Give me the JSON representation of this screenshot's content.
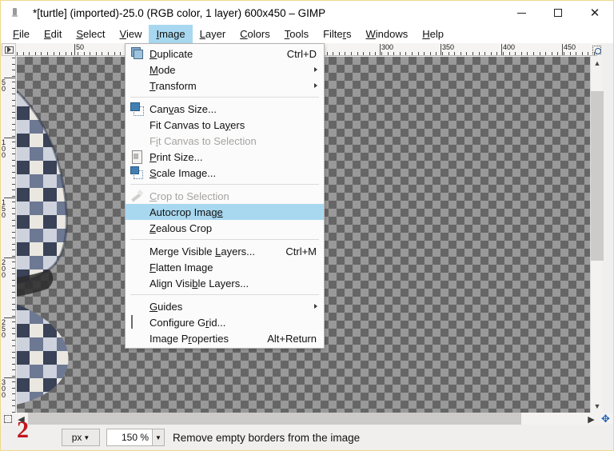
{
  "window": {
    "title": "*[turtle] (imported)-25.0 (RGB color, 1 layer) 600x450 – GIMP",
    "icon": "gimp-wilber-icon",
    "minimize_label": "",
    "maximize_label": "",
    "close_label": "✕"
  },
  "menubar": {
    "items": [
      {
        "label": "File",
        "mnemonic": "F",
        "active": false
      },
      {
        "label": "Edit",
        "mnemonic": "E",
        "active": false
      },
      {
        "label": "Select",
        "mnemonic": "S",
        "active": false
      },
      {
        "label": "View",
        "mnemonic": "V",
        "active": false
      },
      {
        "label": "Image",
        "mnemonic": "I",
        "active": true
      },
      {
        "label": "Layer",
        "mnemonic": "L",
        "active": false
      },
      {
        "label": "Colors",
        "mnemonic": "C",
        "active": false
      },
      {
        "label": "Tools",
        "mnemonic": "T",
        "active": false
      },
      {
        "label": "Filters",
        "mnemonic": "r",
        "active": false
      },
      {
        "label": "Windows",
        "mnemonic": "W",
        "active": false
      },
      {
        "label": "Help",
        "mnemonic": "H",
        "active": false
      }
    ]
  },
  "image_menu": {
    "title": "Image",
    "items": [
      {
        "label": "Duplicate",
        "accel": "Ctrl+D",
        "icon": "duplicate-icon",
        "submenu": false,
        "enabled": true,
        "highlighted": false
      },
      {
        "label": "Mode",
        "accel": "",
        "icon": "",
        "submenu": true,
        "enabled": true,
        "highlighted": false
      },
      {
        "label": "Transform",
        "accel": "",
        "icon": "",
        "submenu": true,
        "enabled": true,
        "highlighted": false
      },
      {
        "separator": true
      },
      {
        "label": "Canvas Size...",
        "accel": "",
        "icon": "canvas-size-icon",
        "submenu": false,
        "enabled": true,
        "highlighted": false
      },
      {
        "label": "Fit Canvas to Layers",
        "accel": "",
        "icon": "",
        "submenu": false,
        "enabled": true,
        "highlighted": false
      },
      {
        "label": "Fit Canvas to Selection",
        "accel": "",
        "icon": "",
        "submenu": false,
        "enabled": false,
        "highlighted": false
      },
      {
        "label": "Print Size...",
        "accel": "",
        "icon": "print-size-icon",
        "submenu": false,
        "enabled": true,
        "highlighted": false
      },
      {
        "label": "Scale Image...",
        "accel": "",
        "icon": "scale-image-icon",
        "submenu": false,
        "enabled": true,
        "highlighted": false
      },
      {
        "separator": true
      },
      {
        "label": "Crop to Selection",
        "accel": "",
        "icon": "crop-icon",
        "submenu": false,
        "enabled": false,
        "highlighted": false
      },
      {
        "label": "Autocrop Image",
        "accel": "",
        "icon": "",
        "submenu": false,
        "enabled": true,
        "highlighted": true
      },
      {
        "label": "Zealous Crop",
        "accel": "",
        "icon": "",
        "submenu": false,
        "enabled": true,
        "highlighted": false
      },
      {
        "separator": true
      },
      {
        "label": "Merge Visible Layers...",
        "accel": "Ctrl+M",
        "icon": "",
        "submenu": false,
        "enabled": true,
        "highlighted": false
      },
      {
        "label": "Flatten Image",
        "accel": "",
        "icon": "",
        "submenu": false,
        "enabled": true,
        "highlighted": false
      },
      {
        "label": "Align Visible Layers...",
        "accel": "",
        "icon": "",
        "submenu": false,
        "enabled": true,
        "highlighted": false
      },
      {
        "separator": true
      },
      {
        "label": "Guides",
        "accel": "",
        "icon": "",
        "submenu": true,
        "enabled": true,
        "highlighted": false
      },
      {
        "label": "Configure Grid...",
        "accel": "",
        "icon": "configure-grid-icon",
        "submenu": false,
        "enabled": true,
        "highlighted": false
      },
      {
        "label": "Image Properties",
        "accel": "Alt+Return",
        "icon": "",
        "submenu": false,
        "enabled": true,
        "highlighted": false
      }
    ]
  },
  "rulers": {
    "horizontal_labels": [
      "50",
      "300",
      "350",
      "400",
      "450"
    ],
    "horizontal_positions": [
      73,
      455,
      531,
      607,
      683
    ],
    "vertical_labels": [
      "50",
      "100",
      "150",
      "200",
      "250",
      "300"
    ],
    "vertical_positions": [
      27,
      102,
      177,
      252,
      327,
      402
    ],
    "unit": "px"
  },
  "canvas": {
    "image_name": "turtle",
    "content_description": "plaid-espadrille-shoe-photo",
    "transparency_checker_light": "#999999",
    "transparency_checker_dark": "#666666"
  },
  "statusbar": {
    "unit": "px",
    "zoom": "150 %",
    "message": "Remove empty borders from the image"
  },
  "annotation": {
    "step_number": "2",
    "color": "#c3161c"
  },
  "icons": {
    "quick_mask": "quick-mask-icon",
    "zoom_follow": "zoom-follow-window-icon",
    "navigation": "navigation-move-icon",
    "scroll_up": "chevron-up-icon",
    "scroll_down": "chevron-down-icon",
    "scroll_right": "chevron-right-icon",
    "ruler_menu": "ruler-corner-menu-icon"
  }
}
